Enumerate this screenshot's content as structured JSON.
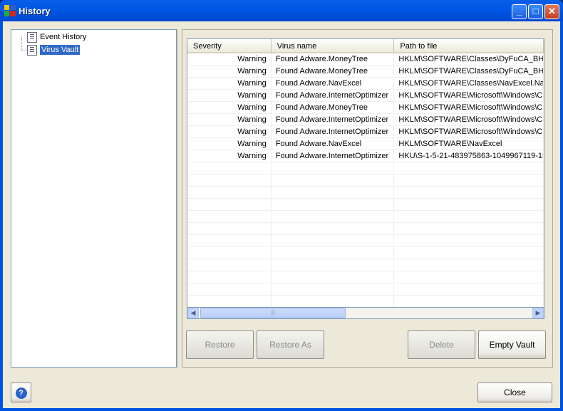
{
  "window": {
    "title": "History",
    "minimize": "_",
    "maximize": "□",
    "close": "✕"
  },
  "tree": [
    {
      "label": "Event History",
      "selected": false
    },
    {
      "label": "Virus Vault",
      "selected": true
    }
  ],
  "table": {
    "columns": [
      "Severity",
      "Virus name",
      "Path to file"
    ],
    "rows": [
      [
        "Warning",
        "Found Adware.MoneyTree",
        "HKLM\\SOFTWARE\\Classes\\DyFuCA_BH"
      ],
      [
        "Warning",
        "Found Adware.MoneyTree",
        "HKLM\\SOFTWARE\\Classes\\DyFuCA_BH"
      ],
      [
        "Warning",
        "Found Adware.NavExcel",
        "HKLM\\SOFTWARE\\Classes\\NavExcel.Na"
      ],
      [
        "Warning",
        "Found Adware.InternetOptimizer",
        "HKLM\\SOFTWARE\\Microsoft\\Windows\\C"
      ],
      [
        "Warning",
        "Found Adware.MoneyTree",
        "HKLM\\SOFTWARE\\Microsoft\\Windows\\C"
      ],
      [
        "Warning",
        "Found Adware.InternetOptimizer",
        "HKLM\\SOFTWARE\\Microsoft\\Windows\\C"
      ],
      [
        "Warning",
        "Found Adware.InternetOptimizer",
        "HKLM\\SOFTWARE\\Microsoft\\Windows\\C"
      ],
      [
        "Warning",
        "Found Adware.NavExcel",
        "HKLM\\SOFTWARE\\NavExcel"
      ],
      [
        "Warning",
        "Found Adware.InternetOptimizer",
        "HKU\\S-1-5-21-483975863-1049967119-15"
      ]
    ]
  },
  "buttons": {
    "restore": "Restore",
    "restore_as": "Restore As",
    "delete": "Delete",
    "empty_vault": "Empty Vault",
    "close": "Close",
    "help": "?"
  }
}
